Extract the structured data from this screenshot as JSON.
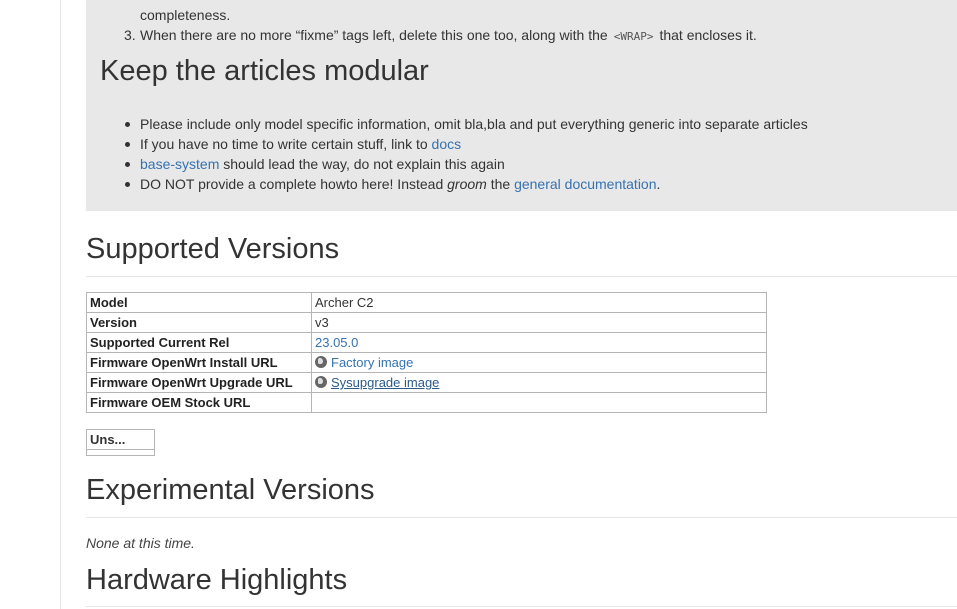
{
  "wrap_box": {
    "ol_continuation": "completeness.",
    "ol_item3_num": "3.",
    "ol_item3_before": "When there are no more “fixme” tags left, delete this one too, along with the",
    "ol_item3_code": "<WRAP>",
    "ol_item3_after": "that encloses it.",
    "heading": "Keep the articles modular",
    "bullets": {
      "b1": "Please include only model specific information, omit bla,bla and put everything generic into separate articles",
      "b2_text": "If you have no time to write certain stuff, link to ",
      "b2_link": "docs",
      "b3_link": "base-system",
      "b3_text": " should lead the way, do not explain this again",
      "b4_text1": "DO NOT provide a complete howto here! Instead ",
      "b4_em": "groom",
      "b4_text2": " the ",
      "b4_link": "general documentation",
      "b4_end": "."
    }
  },
  "supported": {
    "heading": "Supported Versions",
    "rows": [
      {
        "key": "Model",
        "value": "Archer C2"
      },
      {
        "key": "Version",
        "value": "v3"
      },
      {
        "key": "Supported Current Rel",
        "value": "23.05.0"
      },
      {
        "key": "Firmware OpenWrt Install URL",
        "value": "Factory image"
      },
      {
        "key": "Firmware OpenWrt Upgrade URL",
        "value": "Sysupgrade image"
      },
      {
        "key": "Firmware OEM Stock URL",
        "value": ""
      }
    ],
    "mini_label": "Uns..."
  },
  "experimental": {
    "heading": "Experimental Versions",
    "none_text": "None at this time."
  },
  "hardware": {
    "heading": "Hardware Highlights"
  }
}
